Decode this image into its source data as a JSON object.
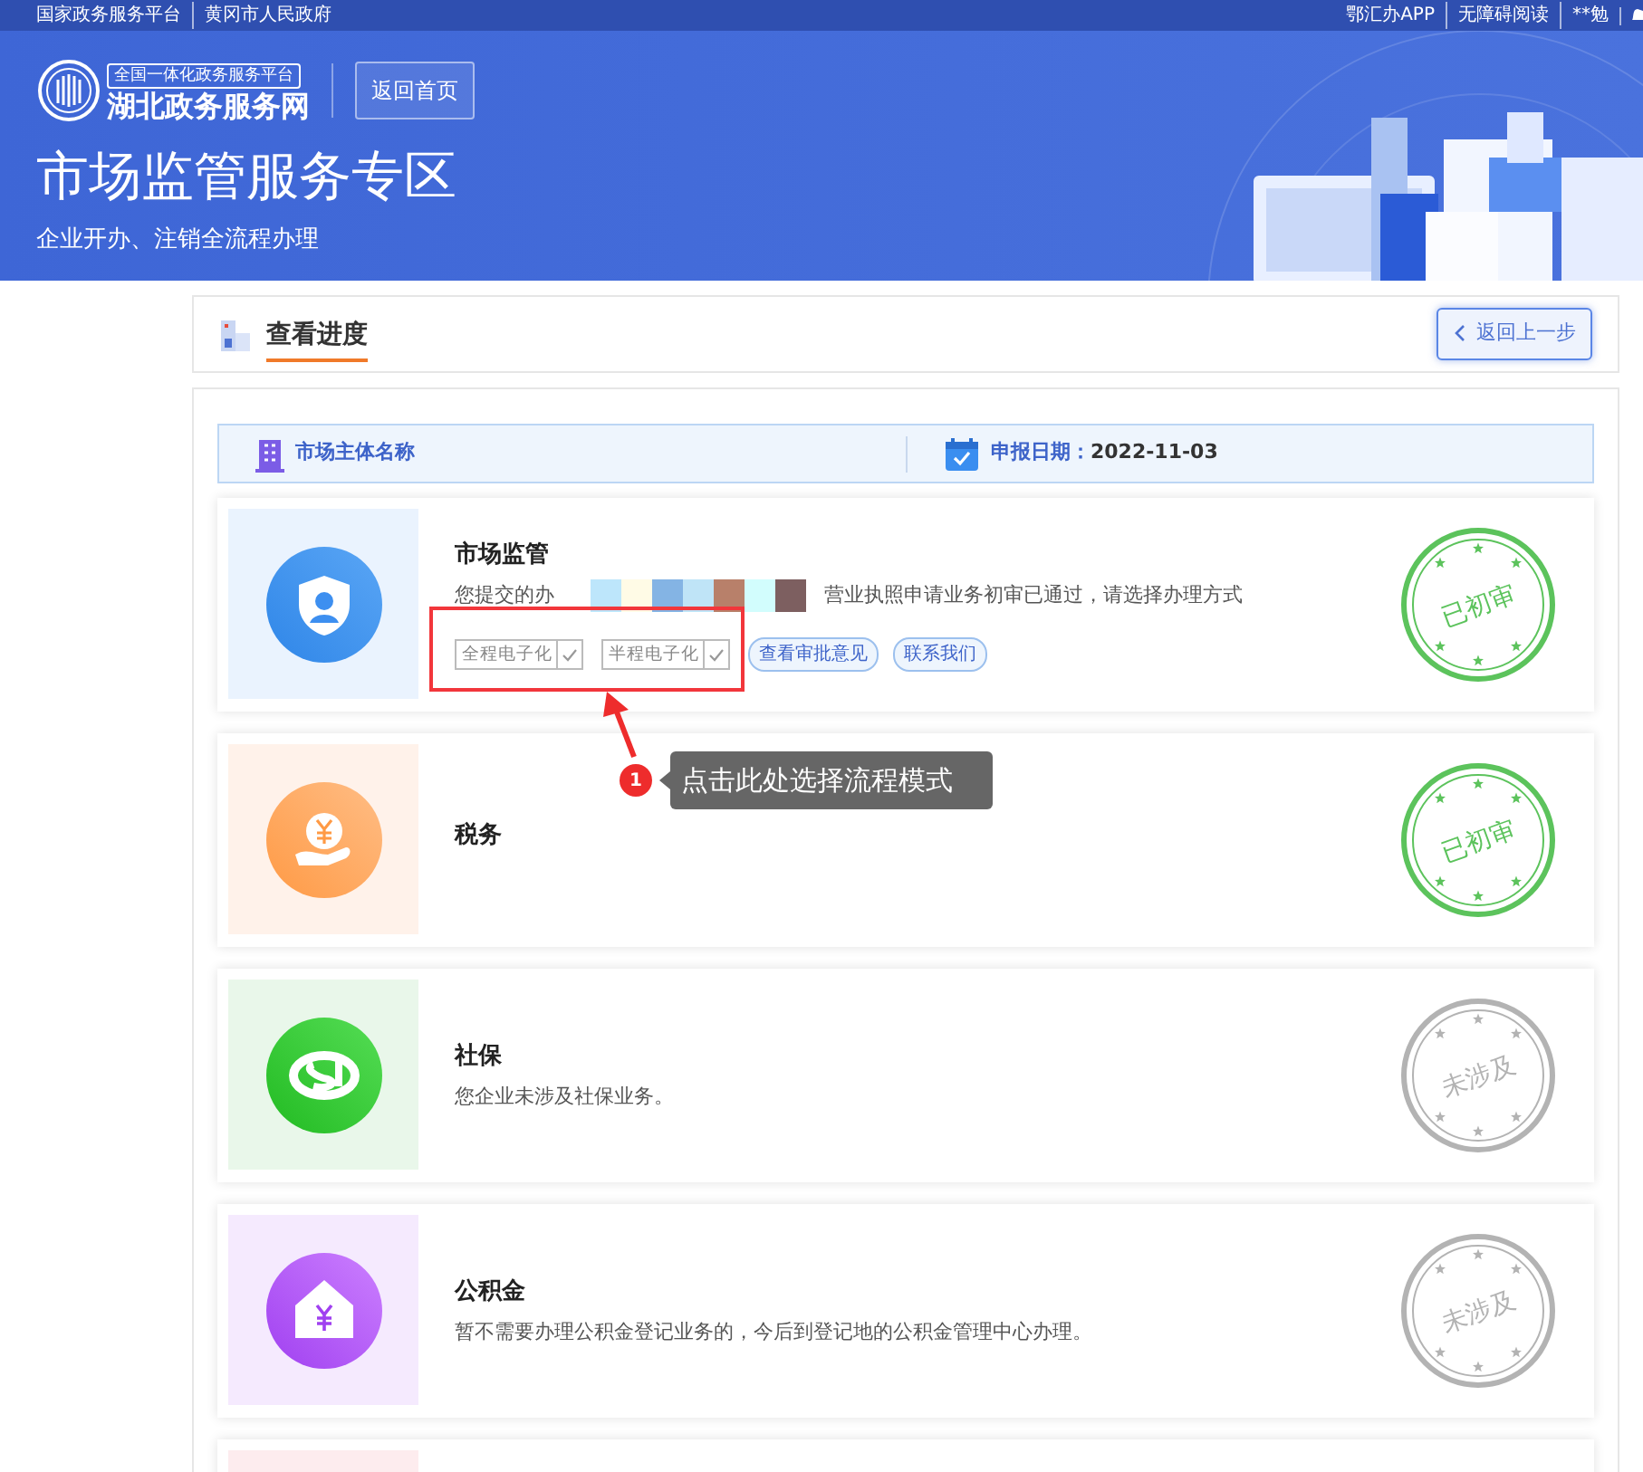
{
  "top_bar": {
    "left_links": [
      "国家政务服务平台",
      "黄冈市人民政府"
    ],
    "right_links": [
      "鄂汇办APP",
      "无障碍阅读",
      "**勉"
    ]
  },
  "header": {
    "logo_top": "全国一体化政务服务平台",
    "logo_name": "湖北政务服务网",
    "home_button": "返回首页",
    "title": "市场监管服务专区",
    "subtitle": "企业开办、注销全流程办理"
  },
  "progress_bar": {
    "title": "查看进度",
    "back_button": "返回上一步"
  },
  "info_bar": {
    "entity_label": "市场主体名称",
    "date_label": "申报日期：",
    "date_value": "2022-11-03"
  },
  "cards": [
    {
      "kind": "shield",
      "color": "#eaf3fe",
      "title": "市场监管",
      "text_before": "您提交的办",
      "redacted": true,
      "text_after": "营业执照申请业务初审已通过，请选择办理方式",
      "approved": true,
      "stamp": "已初审",
      "options": [
        {
          "label": "全程电子化",
          "checked": false
        },
        {
          "label": "半程电子化",
          "checked": false
        }
      ],
      "buttons": [
        "查看审批意见",
        "联系我们"
      ]
    },
    {
      "kind": "coin",
      "color": "#fff2ea",
      "title": "税务",
      "approved": true,
      "stamp": "已初审"
    },
    {
      "kind": "social",
      "color": "#e9f7ea",
      "title": "社保",
      "text_before": "您企业未涉及社保业务。",
      "approved": false,
      "stamp": "未涉及"
    },
    {
      "kind": "house",
      "color": "#f5eafe",
      "title": "公积金",
      "text_before": "暂不需要办理公积金登记业务的，今后到登记地的公积金管理中心办理。",
      "approved": false,
      "stamp": "未涉及"
    },
    {
      "kind": "blank",
      "color": "#fdecee"
    }
  ],
  "annotation": {
    "number": "1",
    "tooltip": "点击此处选择流程模式"
  }
}
